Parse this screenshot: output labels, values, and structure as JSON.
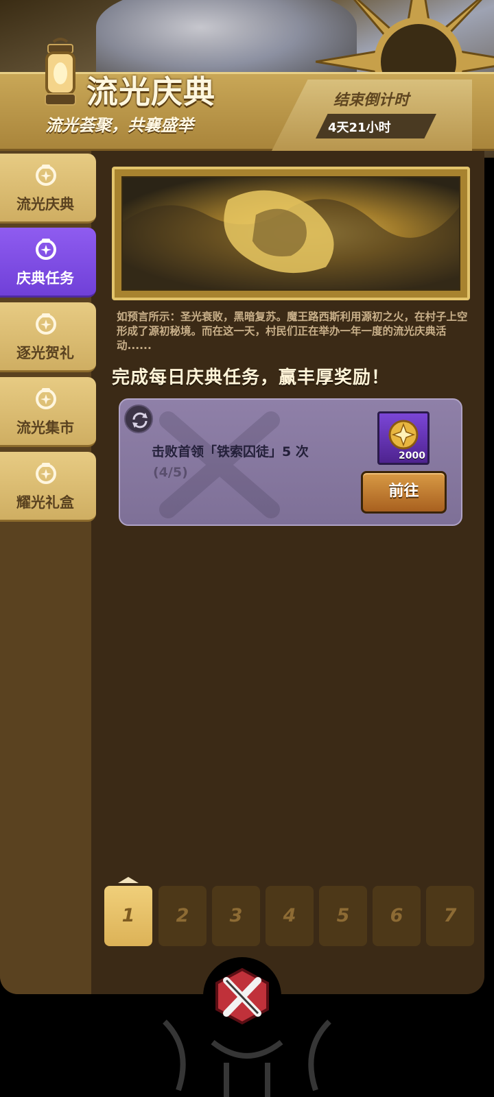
{
  "header": {
    "title": "流光庆典",
    "subtitle": "流光荟聚，共襄盛举",
    "countdown_label": "结束倒计时",
    "countdown_value": "4天21小时"
  },
  "sidebar": {
    "items": [
      {
        "label": "流光庆典",
        "active": false
      },
      {
        "label": "庆典任务",
        "active": true
      },
      {
        "label": "逐光贺礼",
        "active": false
      },
      {
        "label": "流光集市",
        "active": false
      },
      {
        "label": "耀光礼盒",
        "active": false
      }
    ]
  },
  "main": {
    "story": "如预言所示：圣光衰败，黑暗复苏。魔王路西斯利用源初之火，在村子上空形成了源初秘境。而在这一天，村民们正在举办一年一度的流光庆典活动......",
    "heading": "完成每日庆典任务，赢丰厚奖励！",
    "task": {
      "title": "击败首领「铁索囚徒」5 次",
      "progress": "(4/5)",
      "reward_amount": "2000",
      "button_label": "前往"
    }
  },
  "pagination": {
    "pages": [
      "1",
      "2",
      "3",
      "4",
      "5",
      "6",
      "7"
    ],
    "current": "1"
  },
  "colors": {
    "gold": "#e7cb83",
    "active_tab": "#7f4ce6",
    "panel": "#3b2a16",
    "card": "#8a7ba3"
  }
}
